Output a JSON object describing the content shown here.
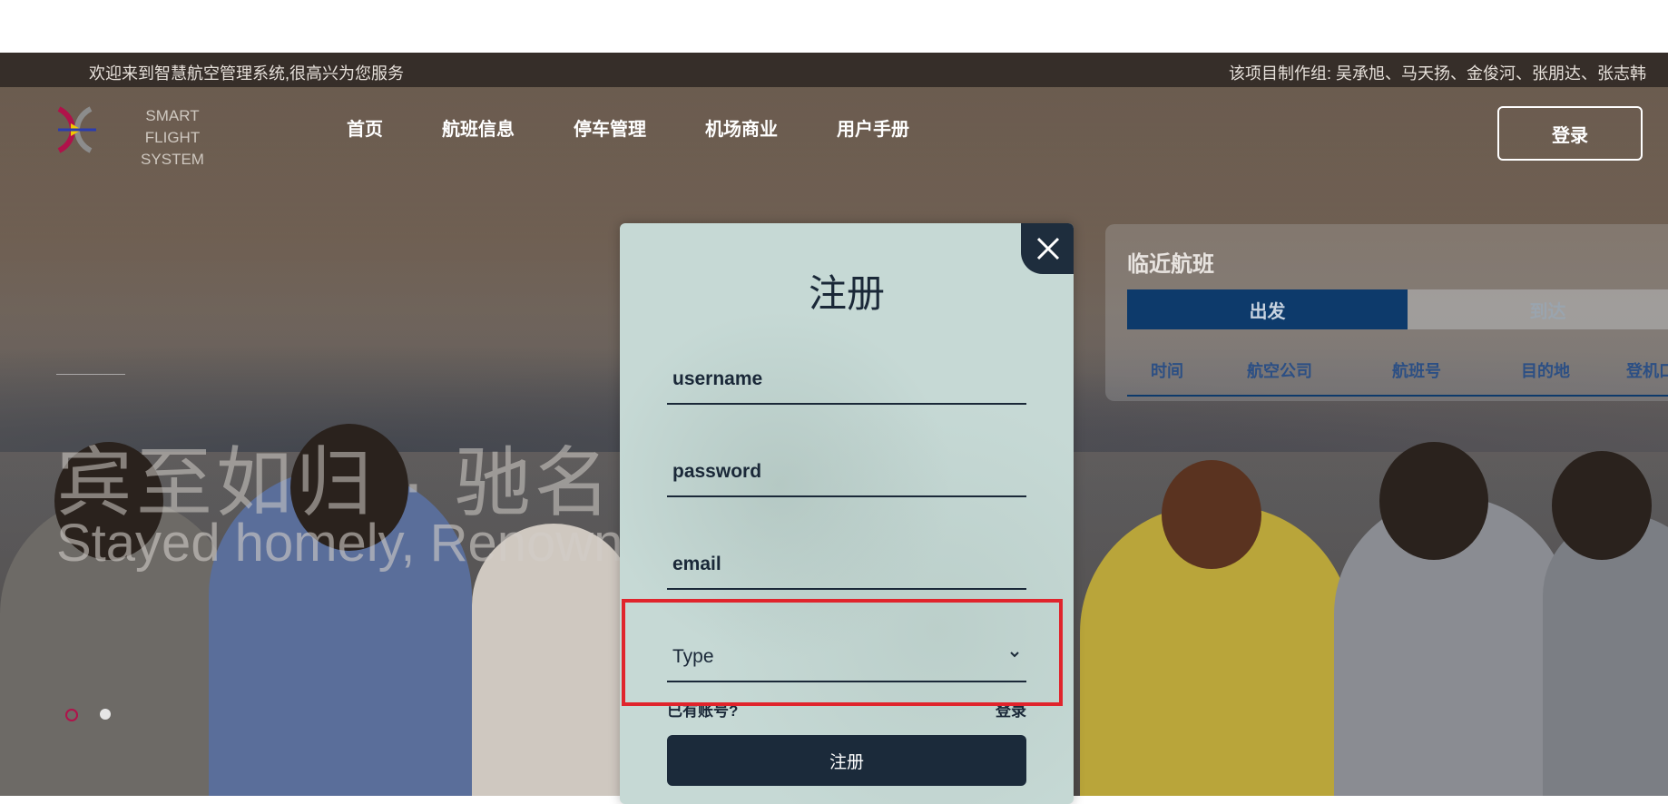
{
  "topbar": {
    "welcome": "欢迎来到智慧航空管理系统,很高兴为您服务",
    "team": "该项目制作组:  吴承旭、马天扬、金俊河、张朋达、张志韩"
  },
  "logo": {
    "line1": "SMART FLIGHT",
    "line2": "SYSTEM"
  },
  "nav": {
    "items": [
      "首页",
      "航班信息",
      "停车管理",
      "机场商业",
      "用户手册"
    ]
  },
  "header": {
    "login_label": "登录"
  },
  "hero": {
    "title_cn": "宾至如归 · 驰名中外",
    "title_en": "Stayed homely, Renowned"
  },
  "flights": {
    "title": "临近航班",
    "tabs": [
      "出发",
      "到达"
    ],
    "columns": [
      "时间",
      "航空公司",
      "航班号",
      "目的地",
      "登机口"
    ]
  },
  "register": {
    "title": "注册",
    "username_placeholder": "username",
    "password_placeholder": "password",
    "email_placeholder": "email",
    "type_placeholder": "Type",
    "have_account": "已有账号?",
    "login_link": "登录",
    "submit_label": "注册"
  },
  "colors": {
    "accent": "#0d3a6b",
    "dark": "#1b2a3a",
    "highlight": "#e0242c"
  }
}
